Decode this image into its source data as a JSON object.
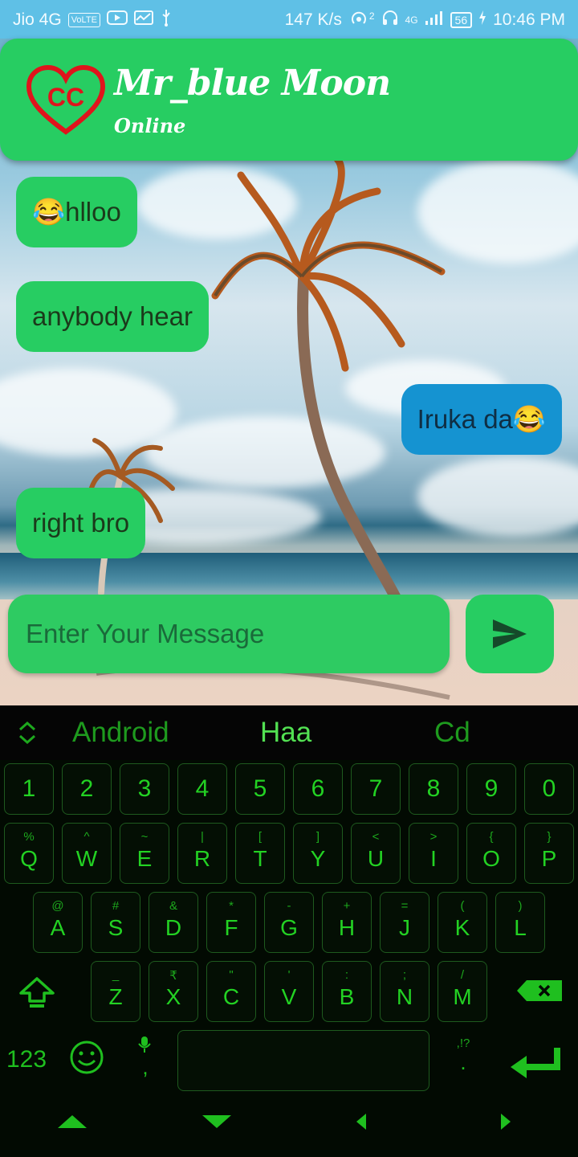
{
  "status_bar": {
    "carrier": "Jio 4G",
    "volte": "VoLTE",
    "speed": "147 K/s",
    "hotspot_count": "2",
    "network": "4G",
    "battery": "56",
    "time": "10:46 PM"
  },
  "header": {
    "logo_text": "CC",
    "contact_name": "Mr_blue Moon",
    "status": "Online"
  },
  "messages": [
    {
      "direction": "incoming",
      "text": "😂hlloo"
    },
    {
      "direction": "incoming",
      "text": "anybody hear"
    },
    {
      "direction": "outgoing",
      "text": "Iruka da😂"
    },
    {
      "direction": "incoming",
      "text": "right bro"
    }
  ],
  "composer": {
    "placeholder": "Enter Your Message",
    "send_icon": "send-icon"
  },
  "keyboard": {
    "suggestions": [
      "Android",
      "Haa",
      "Cd"
    ],
    "number_row": [
      "1",
      "2",
      "3",
      "4",
      "5",
      "6",
      "7",
      "8",
      "9",
      "0"
    ],
    "row1": [
      {
        "key": "Q",
        "alt": "%"
      },
      {
        "key": "W",
        "alt": "^"
      },
      {
        "key": "E",
        "alt": "~"
      },
      {
        "key": "R",
        "alt": "|"
      },
      {
        "key": "T",
        "alt": "["
      },
      {
        "key": "Y",
        "alt": "]"
      },
      {
        "key": "U",
        "alt": "<"
      },
      {
        "key": "I",
        "alt": ">"
      },
      {
        "key": "O",
        "alt": "{"
      },
      {
        "key": "P",
        "alt": "}"
      }
    ],
    "row2": [
      {
        "key": "A",
        "alt": "@"
      },
      {
        "key": "S",
        "alt": "#"
      },
      {
        "key": "D",
        "alt": "&"
      },
      {
        "key": "F",
        "alt": "*"
      },
      {
        "key": "G",
        "alt": "-"
      },
      {
        "key": "H",
        "alt": "+"
      },
      {
        "key": "J",
        "alt": "="
      },
      {
        "key": "K",
        "alt": "("
      },
      {
        "key": "L",
        "alt": ")"
      }
    ],
    "row3": [
      {
        "key": "Z",
        "alt": "_"
      },
      {
        "key": "X",
        "alt": "₹"
      },
      {
        "key": "C",
        "alt": "\""
      },
      {
        "key": "V",
        "alt": "'"
      },
      {
        "key": "B",
        "alt": ":"
      },
      {
        "key": "N",
        "alt": ";"
      },
      {
        "key": "M",
        "alt": "/"
      }
    ],
    "symbols_key": "123",
    "comma": ",",
    "period": ".",
    "period_hint": ",!?"
  },
  "colors": {
    "header_green": "#27cd62",
    "outgoing_blue": "#1593d1",
    "keyboard_green": "#23d223"
  }
}
